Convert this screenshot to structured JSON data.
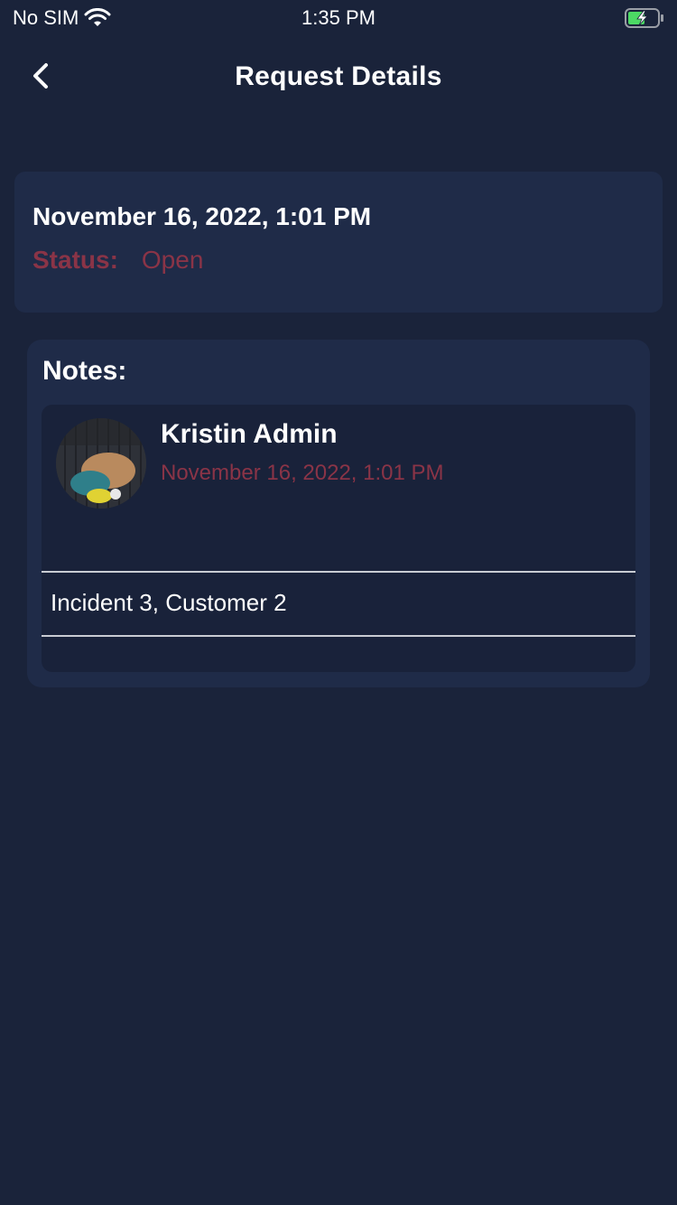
{
  "status_bar": {
    "carrier": "No SIM",
    "time": "1:35 PM"
  },
  "header": {
    "title": "Request Details",
    "back_icon": "chevron-left-icon"
  },
  "request": {
    "date": "November 16, 2022, 1:01 PM",
    "status_label": "Status:",
    "status_value": "Open"
  },
  "notes": {
    "title": "Notes:",
    "items": [
      {
        "author": "Kristin Admin",
        "date": "November 16, 2022, 1:01 PM",
        "text": "Incident 3, Customer 2"
      }
    ]
  },
  "colors": {
    "background": "#1a233a",
    "card": "#1f2b48",
    "note_card": "#19223a",
    "accent_status": "#8a3447",
    "battery_charge": "#4cd964"
  }
}
